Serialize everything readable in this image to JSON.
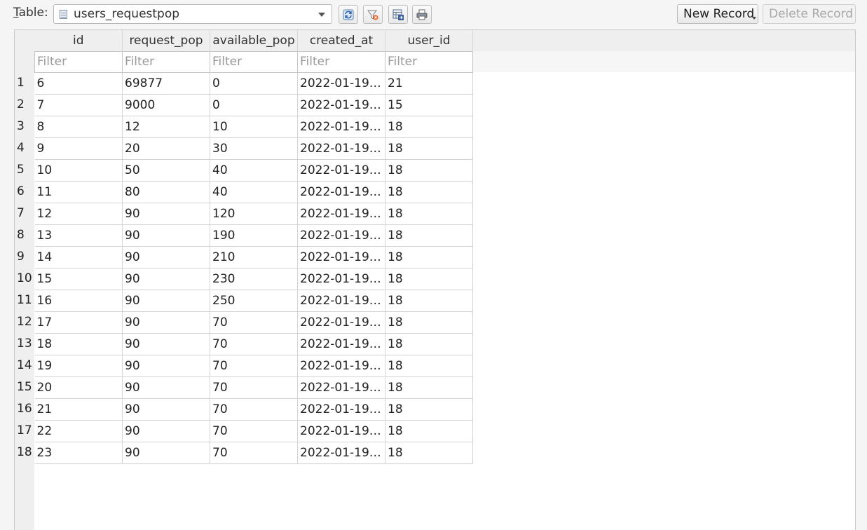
{
  "toolbar": {
    "table_label_first": "T",
    "table_label_rest": "able:",
    "table_selected": "users_requestpop",
    "new_record_label": "New Record",
    "delete_record_label": "Delete Record"
  },
  "grid": {
    "columns": [
      "id",
      "request_pop",
      "available_pop",
      "created_at",
      "user_id"
    ],
    "filter_placeholder": "Filter",
    "row_numbers": [
      "1",
      "2",
      "3",
      "4",
      "5",
      "6",
      "7",
      "8",
      "9",
      "10",
      "11",
      "12",
      "13",
      "14",
      "15",
      "16",
      "17",
      "18"
    ],
    "rows": [
      [
        "6",
        "69877",
        "0",
        "2022-01-19…",
        "21"
      ],
      [
        "7",
        "9000",
        "0",
        "2022-01-19…",
        "15"
      ],
      [
        "8",
        "12",
        "10",
        "2022-01-19…",
        "18"
      ],
      [
        "9",
        "20",
        "30",
        "2022-01-19…",
        "18"
      ],
      [
        "10",
        "50",
        "40",
        "2022-01-19…",
        "18"
      ],
      [
        "11",
        "80",
        "40",
        "2022-01-19…",
        "18"
      ],
      [
        "12",
        "90",
        "120",
        "2022-01-19…",
        "18"
      ],
      [
        "13",
        "90",
        "190",
        "2022-01-19…",
        "18"
      ],
      [
        "14",
        "90",
        "210",
        "2022-01-19…",
        "18"
      ],
      [
        "15",
        "90",
        "230",
        "2022-01-19…",
        "18"
      ],
      [
        "16",
        "90",
        "250",
        "2022-01-19…",
        "18"
      ],
      [
        "17",
        "90",
        "70",
        "2022-01-19…",
        "18"
      ],
      [
        "18",
        "90",
        "70",
        "2022-01-19…",
        "18"
      ],
      [
        "19",
        "90",
        "70",
        "2022-01-19…",
        "18"
      ],
      [
        "20",
        "90",
        "70",
        "2022-01-19…",
        "18"
      ],
      [
        "21",
        "90",
        "70",
        "2022-01-19…",
        "18"
      ],
      [
        "22",
        "90",
        "70",
        "2022-01-19…",
        "18"
      ],
      [
        "23",
        "90",
        "70",
        "2022-01-19…",
        "18"
      ]
    ]
  },
  "icons": {
    "refresh": "refresh-icon",
    "clear_filters": "clear-filters-icon",
    "save_table": "save-table-icon",
    "print": "print-icon"
  }
}
